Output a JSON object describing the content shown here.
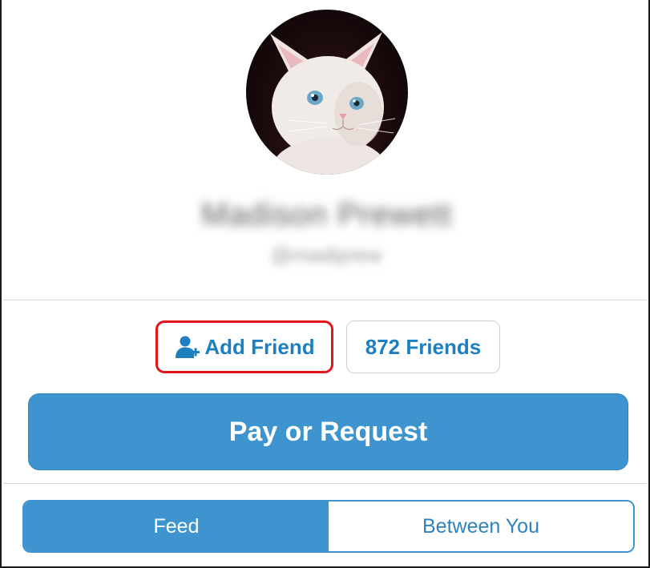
{
  "profile": {
    "name": "Madison Prewett",
    "handle": "@madiprew",
    "avatar_description": "white-kitten-photo"
  },
  "friends": {
    "add_friend_label": "Add Friend",
    "add_friend_icon": "add-person-icon",
    "friends_count_label": "872 Friends"
  },
  "actions": {
    "pay_or_request_label": "Pay or Request"
  },
  "tabs": [
    {
      "label": "Feed",
      "active": true
    },
    {
      "label": "Between You",
      "active": false
    }
  ],
  "colors": {
    "accent": "#3d94cf",
    "link_text": "#1d7fc0",
    "highlight_box": "#e3151b"
  }
}
